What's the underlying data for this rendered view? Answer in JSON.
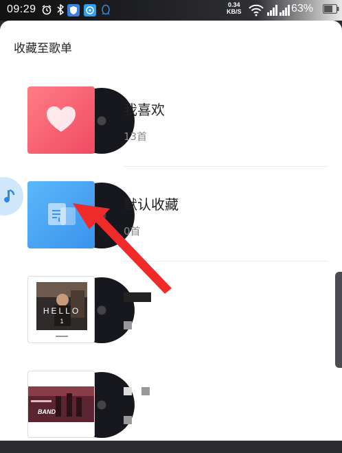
{
  "status_bar": {
    "time": "09:29",
    "net_speed_value": "0.34",
    "net_speed_unit": "KB/S",
    "battery": "63%"
  },
  "sheet": {
    "title": "收藏至歌单",
    "playlists": [
      {
        "name": "我喜欢",
        "count": "13首",
        "cover": "heart-cover",
        "cover_color": "#f2546a"
      },
      {
        "name": "默认收藏",
        "count": "0首",
        "cover": "music-folder-cover",
        "cover_color": "#4aa6f5"
      },
      {
        "name": "",
        "count": "",
        "cover": "album-art-hello",
        "redacted": true
      },
      {
        "name": "",
        "count": "",
        "cover": "album-art-concert",
        "redacted": true
      }
    ]
  },
  "annotation": {
    "arrow_color": "#ee2a2a"
  },
  "colors": {
    "accent": "#4aa6f5",
    "heart": "#f2546a"
  }
}
